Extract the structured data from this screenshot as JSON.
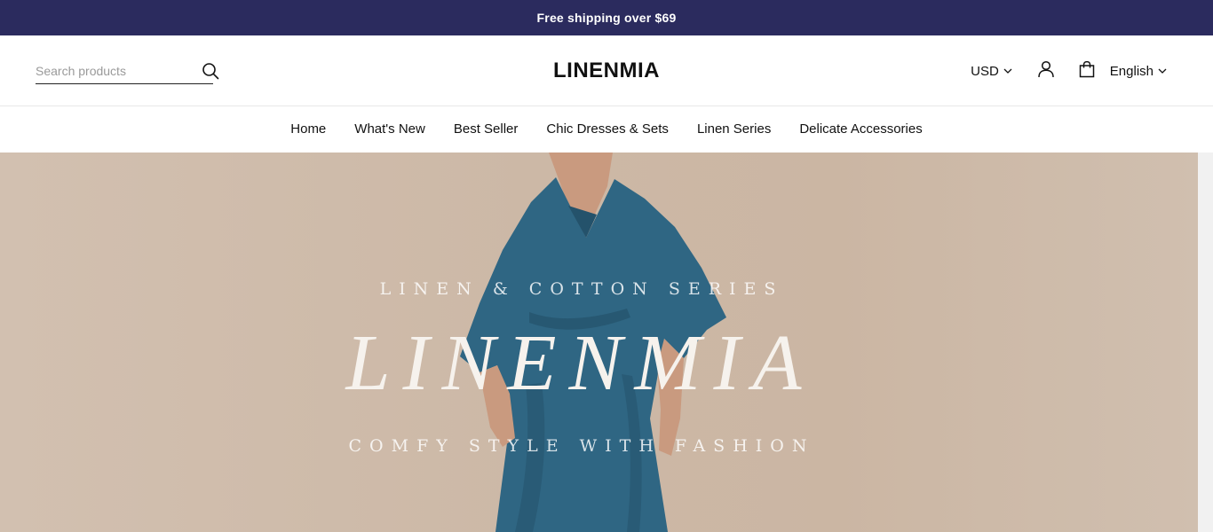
{
  "announcement": {
    "text": "Free shipping over $69"
  },
  "header": {
    "search_placeholder": "Search products",
    "search_icon": "search-icon",
    "logo": "LINENMIA",
    "currency": "USD",
    "account_icon": "user-icon",
    "cart_icon": "shopping-bag-icon",
    "language": "English"
  },
  "nav": {
    "items": [
      {
        "label": "Home"
      },
      {
        "label": "What's New"
      },
      {
        "label": "Best Seller"
      },
      {
        "label": "Chic Dresses & Sets"
      },
      {
        "label": "Linen Series"
      },
      {
        "label": "Delicate Accessories"
      }
    ]
  },
  "hero": {
    "supertitle": "LINEN & COTTON SERIES",
    "title": "LINENMIA",
    "subtitle": "COMFY STYLE WITH FASHION",
    "colors": {
      "background": "#cdb9a7",
      "dress": "#2f6683",
      "skin": "#c99a7f"
    }
  },
  "colors": {
    "announcement_bg": "#2b2b5e",
    "text": "#111111"
  }
}
